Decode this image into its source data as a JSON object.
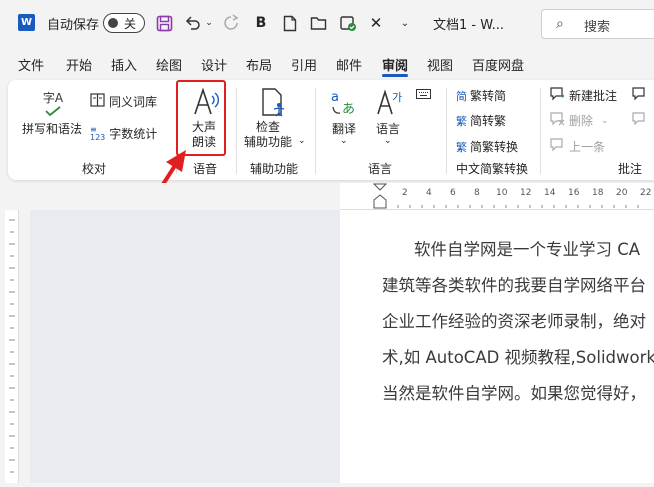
{
  "titlebar": {
    "app_logo": "W",
    "autosave_label": "自动保存",
    "autosave_state": "关",
    "doc_title": "文档1 - W...",
    "search_placeholder": "搜索",
    "icons": [
      "save-icon",
      "undo-icon",
      "redo-icon",
      "bold-icon",
      "new-doc-icon",
      "open-folder-icon",
      "save-check-icon",
      "close-x-icon",
      "customize-chevron-icon"
    ]
  },
  "tabs": [
    "文件",
    "开始",
    "插入",
    "绘图",
    "设计",
    "布局",
    "引用",
    "邮件",
    "审阅",
    "视图",
    "百度网盘"
  ],
  "active_tab": "审阅",
  "ribbon": {
    "proofing": {
      "spelling": "拼写和语法",
      "spelling_icon_text": "字A",
      "thesaurus": "同义词库",
      "word_count": "字数统计",
      "group_label": "校对"
    },
    "speech": {
      "read_aloud_line1": "大声",
      "read_aloud_line2": "朗读",
      "group_label": "语音"
    },
    "accessibility": {
      "check_line1": "检查",
      "check_line2": "辅助功能",
      "group_label": "辅助功能"
    },
    "language": {
      "translate": "翻译",
      "language": "语言",
      "group_label": "语言"
    },
    "chinese_conversion": {
      "to_traditional": "繁转简",
      "to_simplified": "简转繁",
      "convert": "简繁转换",
      "group_label": "中文简繁转换"
    },
    "comments": {
      "new_comment": "新建批注",
      "delete": "删除",
      "previous": "上一条",
      "group_label": "批注"
    }
  },
  "ruler": {
    "h_ticks": [
      "2",
      "4",
      "6",
      "8",
      "10",
      "12",
      "14",
      "16",
      "18",
      "20",
      "22"
    ]
  },
  "document": {
    "lines": [
      "软件自学网是一个专业学习 CA",
      "建筑等各类软件的我要自学网络平台",
      "企业工作经验的资深老师录制，绝对",
      "术,如 AutoCAD 视频教程,Solidworks",
      "当然是软件自学网。如果您觉得好，"
    ]
  },
  "colors": {
    "accent": "#185abd",
    "highlight": "#e02020",
    "save_icon": "#8b3aa8"
  }
}
